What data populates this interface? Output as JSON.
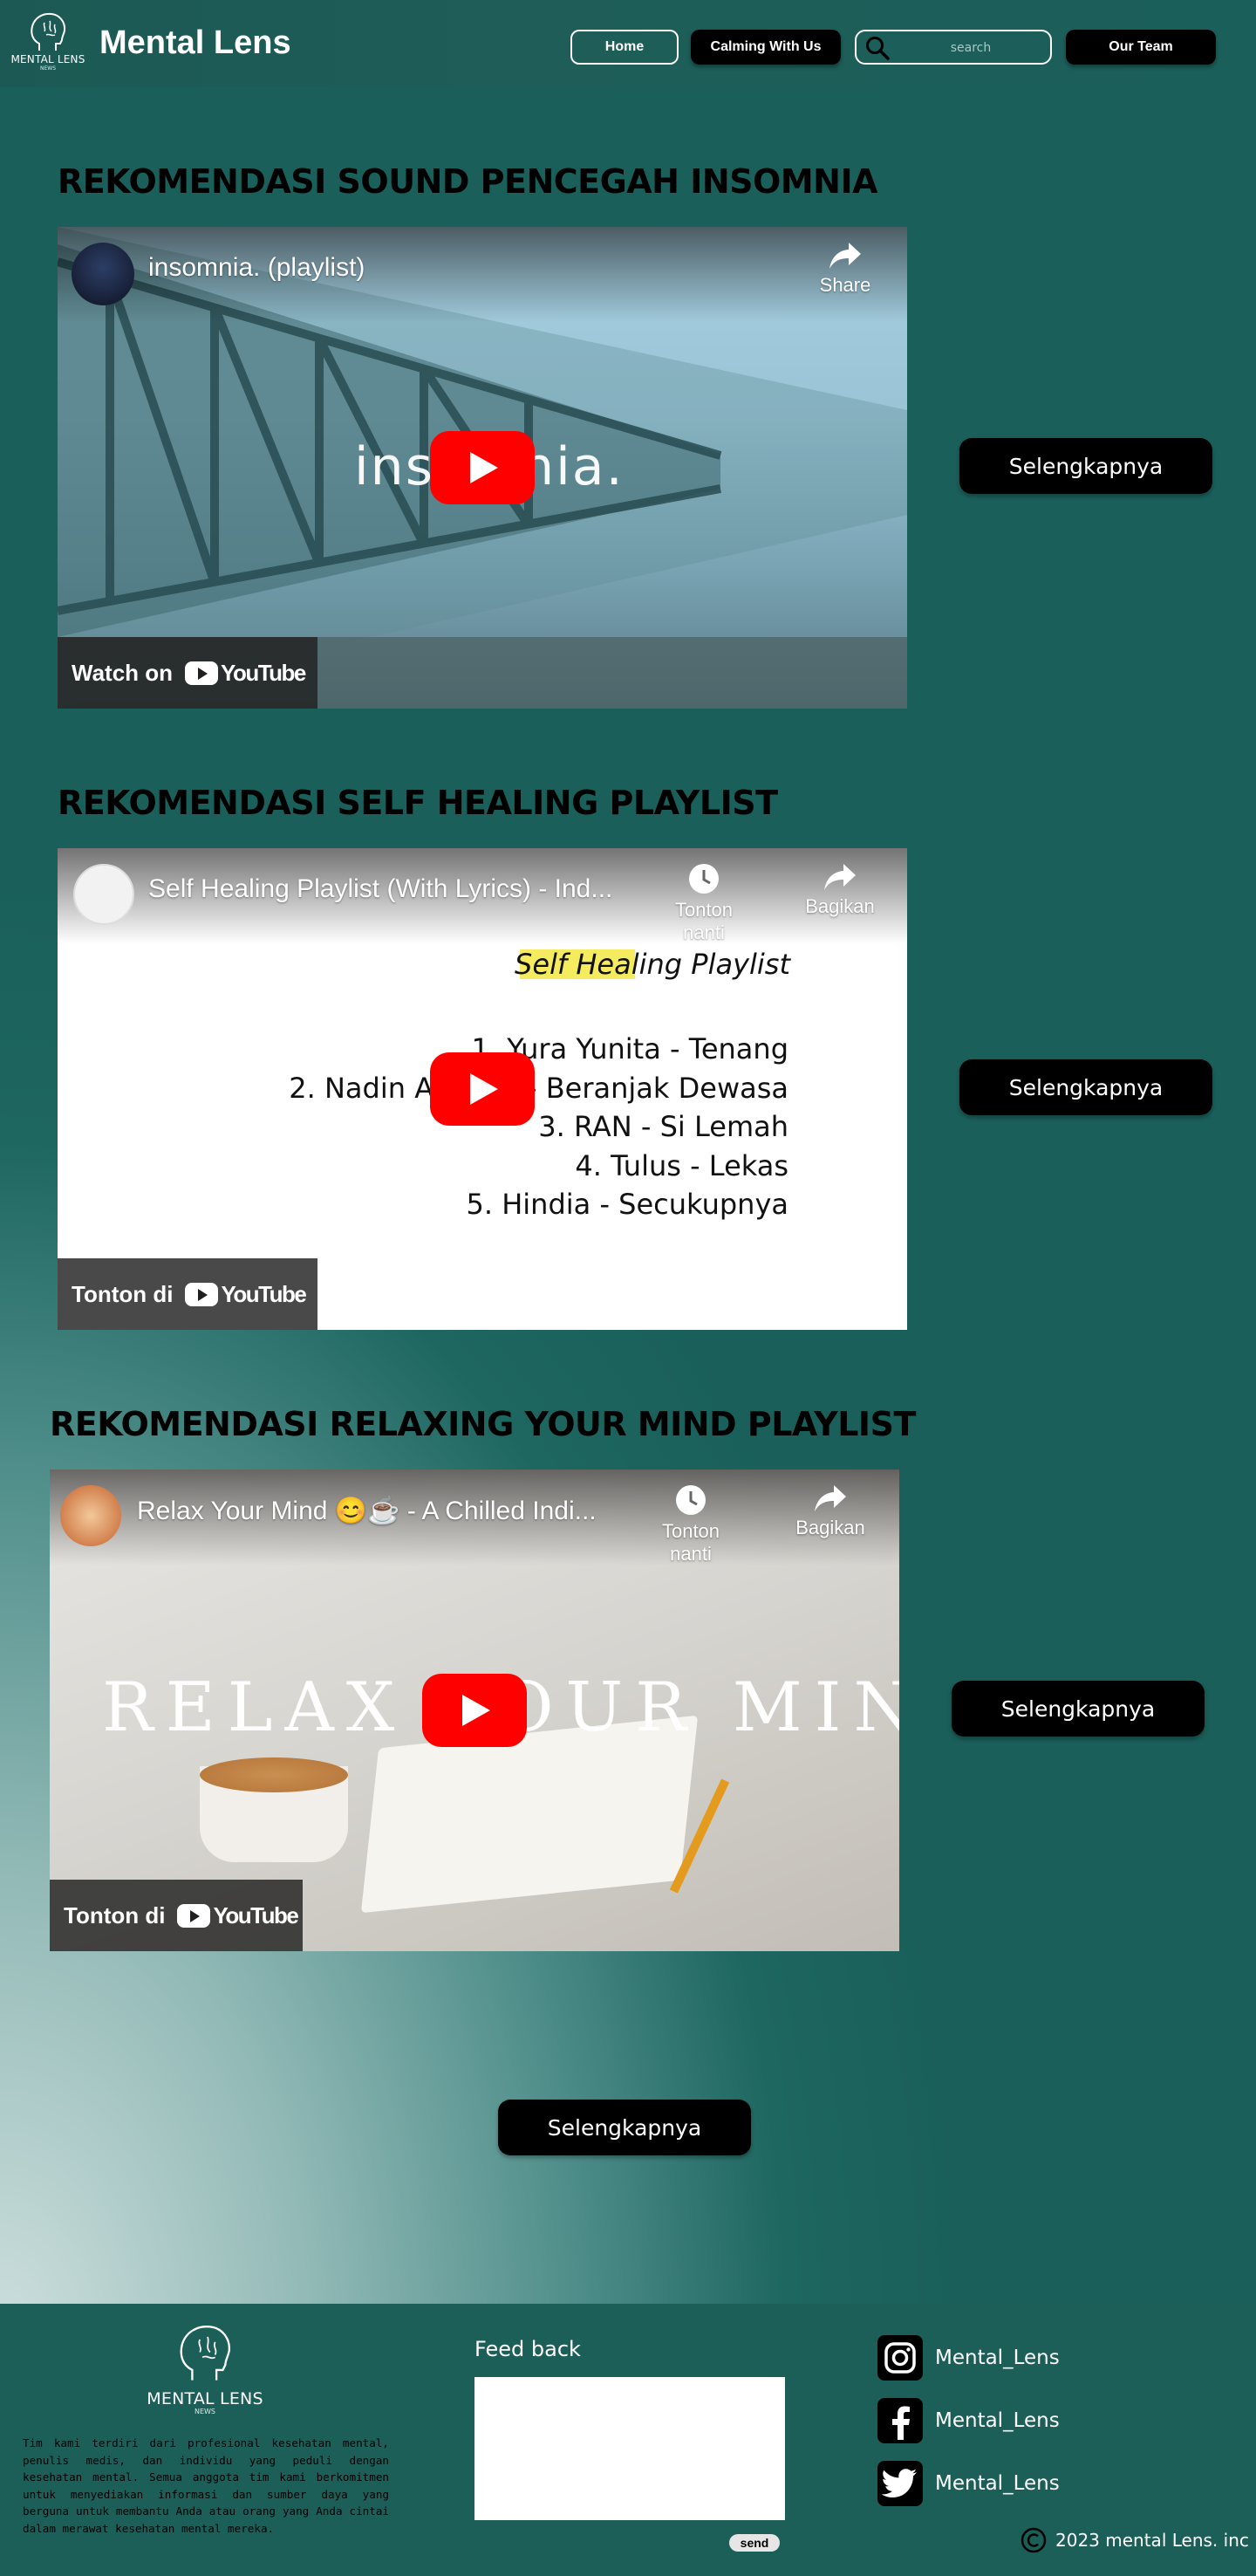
{
  "header": {
    "logo_text": "MENTAL LENS",
    "logo_sub": "NEWS",
    "brand": "Mental Lens",
    "nav": {
      "home": "Home",
      "calming": "Calming With Us",
      "team": "Our Team"
    },
    "search_placeholder": "search"
  },
  "sections": [
    {
      "title": "REKOMENDASI SOUND PENCEGAH INSOMNIA",
      "video_title": "insomnia. (playlist)",
      "actions": [
        "Share"
      ],
      "overlay_text": "insomnia.",
      "watch_label": "Watch on",
      "button": "Selengkapnya"
    },
    {
      "title": "REKOMENDASI SELF HEALING PLAYLIST",
      "video_title": "Self Healing Playlist (With Lyrics) - Ind...",
      "actions": [
        "Tonton nanti",
        "Bagikan"
      ],
      "playlist_heading": "Self Healing Playlist",
      "playlist": [
        "1. Yura Yunita - Tenang",
        "2. Nadin Amizah - Beranjak Dewasa",
        "3. RAN - Si Lemah",
        "4. Tulus - Lekas",
        "5. Hindia - Secukupnya"
      ],
      "watch_label": "Tonton di",
      "button": "Selengkapnya"
    },
    {
      "title": "REKOMENDASI RELAXING YOUR MIND PLAYLIST",
      "video_title": "Relax Your Mind 😊☕ - A Chilled Indi...",
      "actions": [
        "Tonton nanti",
        "Bagikan"
      ],
      "overlay_text": "RELAX YOUR MIND",
      "watch_label": "Tonton di",
      "button": "Selengkapnya"
    }
  ],
  "bottom_button": "Selengkapnya",
  "youtube_word": "YouTube",
  "footer": {
    "logo_text": "MENTAL LENS",
    "logo_sub": "NEWS",
    "about": "Tim kami terdiri dari profesional kesehatan mental, penulis medis, dan individu yang peduli dengan kesehatan mental. Semua anggota tim kami berkomitmen untuk menyediakan informasi dan sumber daya yang berguna untuk membantu Anda atau orang yang Anda cintai dalam merawat kesehatan mental mereka.",
    "feedback_label": "Feed back",
    "send": "send",
    "socials": [
      {
        "icon": "instagram-icon",
        "label": "Mental_Lens"
      },
      {
        "icon": "facebook-icon",
        "label": "Mental_Lens"
      },
      {
        "icon": "twitter-icon",
        "label": "Mental_Lens"
      }
    ],
    "copyright": "2023 mental Lens. inc"
  }
}
